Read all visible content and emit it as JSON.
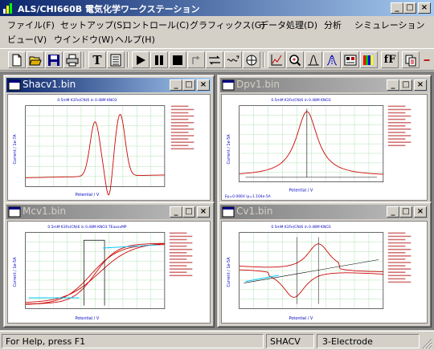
{
  "app": {
    "title": "ALS/CHI660B 電気化学ワークステーション"
  },
  "menu": {
    "row1": [
      "ファイル(F)",
      "セットアップ(S)",
      "コントロール(C)",
      "グラフィックス(G)",
      "データ処理(D)",
      "分析",
      "シミュレーション"
    ],
    "row2": [
      "ビュー(V)",
      "ウインドウ(W)",
      "ヘルプ(H)"
    ]
  },
  "toolbar": {
    "icons": [
      "new-icon",
      "open-icon",
      "save-icon",
      "print-icon",
      "technique-icon",
      "parameters-icon",
      "run-icon",
      "pause-icon",
      "stop-icon",
      "reverse-scan-icon",
      "ir-comp-icon",
      "filter-icon",
      "cell-control-icon",
      "present-data-plot-icon",
      "zoom-icon",
      "manual-result-icon",
      "peak-definition-icon",
      "graph-options-icon",
      "color-icon",
      "font-icon",
      "copy-icon"
    ],
    "text_t": "T",
    "text_ff": "fF"
  },
  "windows": [
    {
      "name": "Shacv1.bin",
      "active": true,
      "plot_title": "0.5mM K3Fe(CN)6 in 0.48M KNO3",
      "xlabel": "Potential / V",
      "ylabel": "Current / 1e-7A"
    },
    {
      "name": "Dpv1.bin",
      "active": false,
      "plot_title": "0.5mM K3Fe(CN)6 in 0.48M KNO3",
      "xlabel": "Potential / V",
      "ylabel": "Current / 1e-5A",
      "footer": "Ep=0.066V    ip=1.104e-5A"
    },
    {
      "name": "Mcv1.bin",
      "active": false,
      "plot_title": "0.5mM K3Fe(CN)6 in 0.48M KNO3 TEaxxxMP",
      "xlabel": "Potential / V",
      "ylabel": "Current / 1e-5A"
    },
    {
      "name": "Cv1.bin",
      "active": false,
      "plot_title": "0.5mM K3Fe(CN)6 in 0.48M KNO3",
      "xlabel": "Potential / V",
      "ylabel": "Current / 1e-5A"
    }
  ],
  "status": {
    "help": "For Help, press F1",
    "technique": "SHACV",
    "electrode": "3-Electrode"
  },
  "colors": {
    "active_title": "#0a246a",
    "inactive_title": "#808080",
    "curve": "#cc0000",
    "grid": "#00a000"
  }
}
